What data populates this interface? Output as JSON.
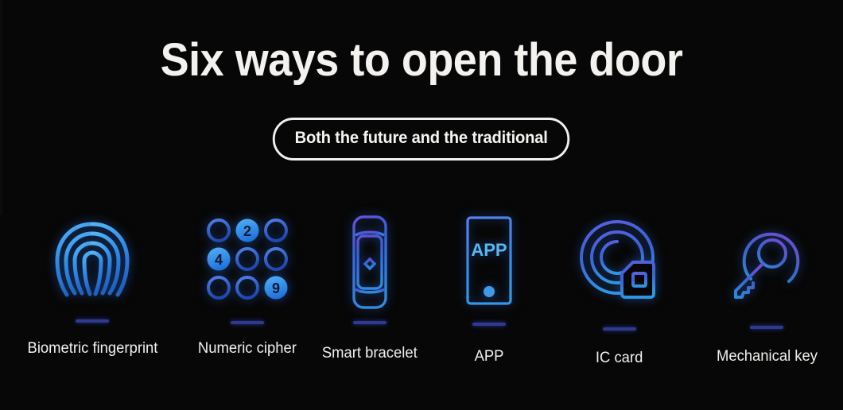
{
  "banner": {
    "title": "Six ways to open the door",
    "subtitle_pill": "Both the future and the traditional",
    "background_color": "#070707",
    "title_color": "#f4f2ef",
    "accent_color": "#2f7fe0",
    "divider_color": "#2f3a8f"
  },
  "methods": [
    {
      "label": "Biometric fingerprint",
      "icon": "fingerprint-icon",
      "icon_color": "#2f8ae6"
    },
    {
      "label": "Numeric cipher",
      "icon": "numeric-keypad-icon",
      "icon_color": "#2f7fe0",
      "keypad": {
        "rows": [
          [
            "",
            "2",
            ""
          ],
          [
            "4",
            "",
            ""
          ],
          [
            "",
            "",
            "9"
          ]
        ],
        "filled_keys": [
          "2",
          "4",
          "9"
        ]
      }
    },
    {
      "label": "Smart bracelet",
      "icon": "smart-bracelet-icon",
      "icon_color": "#3a5fd0"
    },
    {
      "label": "APP",
      "icon": "smartphone-app-icon",
      "icon_color": "#3f86e6",
      "screen_text": "APP"
    },
    {
      "label": "IC card",
      "icon": "ic-card-nfc-icon",
      "icon_color": "#3a63d6"
    },
    {
      "label": "Mechanical key",
      "icon": "mechanical-key-icon",
      "icon_color": "#3f63c8"
    }
  ]
}
